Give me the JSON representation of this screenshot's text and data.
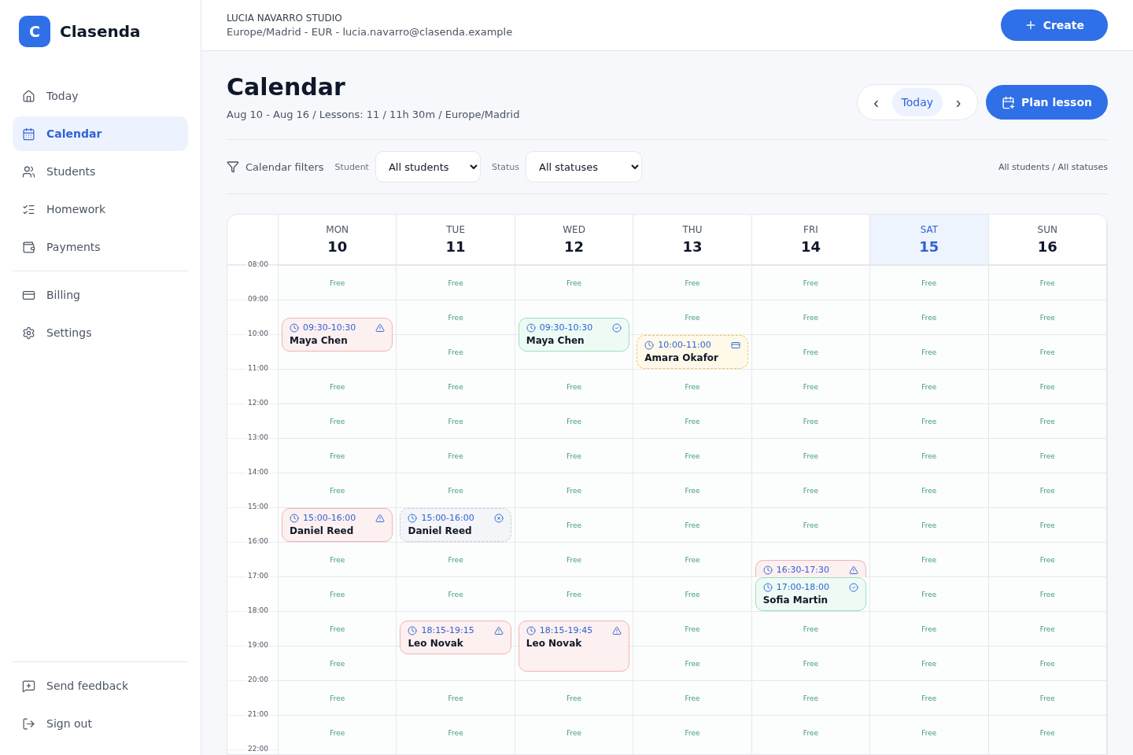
{
  "brand": {
    "logo_letter": "C",
    "name": "Clasenda"
  },
  "sidebar": {
    "items": [
      {
        "label": "Today",
        "selected": false
      },
      {
        "label": "Calendar",
        "selected": true
      },
      {
        "label": "Students",
        "selected": false
      },
      {
        "label": "Homework",
        "selected": false
      },
      {
        "label": "Payments",
        "selected": false
      }
    ],
    "secondary_items": [
      {
        "label": "Billing",
        "selected": false
      },
      {
        "label": "Settings",
        "selected": false
      }
    ],
    "footer_items": [
      {
        "label": "Send feedback"
      },
      {
        "label": "Sign out"
      }
    ]
  },
  "topbar": {
    "studio": "LUCIA NAVARRO STUDIO",
    "details": "Europe/Madrid - EUR - lucia.navarro@clasenda.example",
    "create_button": "Create"
  },
  "page": {
    "title": "Calendar",
    "subtitle": "Aug 10 - Aug 16 / Lessons: 11 / 11h 30m / Europe/Madrid",
    "nav": {
      "prev": "‹",
      "today": "Today",
      "next": "›"
    },
    "plan_button": "Plan lesson"
  },
  "filters": {
    "label": "Calendar filters",
    "student": {
      "label": "Student",
      "value": "All students"
    },
    "status": {
      "label": "Status",
      "value": "All statuses"
    },
    "summary": "All students / All statuses"
  },
  "calendar": {
    "hours": [
      "08:00",
      "09:00",
      "10:00",
      "11:00",
      "12:00",
      "13:00",
      "14:00",
      "15:00",
      "16:00",
      "17:00",
      "18:00",
      "19:00",
      "20:00",
      "21:00",
      "22:00"
    ],
    "days": [
      {
        "dow": "MON",
        "date": "10",
        "selected": false,
        "cells": [
          "Free",
          "",
          "",
          "Free",
          "Free",
          "Free",
          "Free",
          "",
          "Free",
          "Free",
          "Free",
          "Free",
          "Free",
          "Free"
        ],
        "events": [
          {
            "kind": "warning",
            "time": "09:30-10:30",
            "name": "Maya Chen"
          },
          {
            "kind": "warning",
            "time": "15:00-16:00",
            "name": "Daniel Reed"
          }
        ]
      },
      {
        "dow": "TUE",
        "date": "11",
        "selected": false,
        "cells": [
          "Free",
          "Free",
          "Free",
          "Free",
          "Free",
          "Free",
          "Free",
          "",
          "Free",
          "Free",
          "",
          "",
          "Free",
          "Free"
        ],
        "events": [
          {
            "kind": "cancelled",
            "time": "15:00-16:00",
            "name": "Daniel Reed"
          },
          {
            "kind": "warning",
            "time": "18:15-19:15",
            "name": "Leo Novak"
          }
        ]
      },
      {
        "dow": "WED",
        "date": "12",
        "selected": false,
        "cells": [
          "Free",
          "",
          "",
          "Free",
          "Free",
          "Free",
          "Free",
          "Free",
          "Free",
          "Free",
          "",
          "",
          "Free",
          "Free"
        ],
        "events": [
          {
            "kind": "done",
            "time": "09:30-10:30",
            "name": "Maya Chen"
          },
          {
            "kind": "warning",
            "time": "18:15-19:45",
            "name": "Leo Novak"
          }
        ]
      },
      {
        "dow": "THU",
        "date": "13",
        "selected": false,
        "cells": [
          "Free",
          "Free",
          "",
          "Free",
          "Free",
          "Free",
          "Free",
          "Free",
          "Free",
          "Free",
          "Free",
          "Free",
          "Free",
          "Free"
        ],
        "events": [
          {
            "kind": "unpaid",
            "time": "10:00-11:00",
            "name": "Amara Okafor"
          }
        ]
      },
      {
        "dow": "FRI",
        "date": "14",
        "selected": false,
        "cells": [
          "Free",
          "Free",
          "Free",
          "Free",
          "Free",
          "Free",
          "Free",
          "Free",
          "",
          "",
          "Free",
          "Free",
          "Free",
          "Free"
        ],
        "events": [
          {
            "kind": "warning",
            "time": "16:30-17:30"
          },
          {
            "kind": "done",
            "time": "17:00-18:00",
            "name": "Sofia Martin"
          }
        ]
      },
      {
        "dow": "SAT",
        "date": "15",
        "selected": true,
        "cells": [
          "Free",
          "Free",
          "Free",
          "Free",
          "Free",
          "Free",
          "Free",
          "Free",
          "Free",
          "Free",
          "Free",
          "Free",
          "Free",
          "Free"
        ]
      },
      {
        "dow": "SUN",
        "date": "16",
        "selected": false,
        "cells": [
          "Free",
          "Free",
          "Free",
          "Free",
          "Free",
          "Free",
          "Free",
          "Free",
          "Free",
          "Free",
          "Free",
          "Free",
          "Free",
          "Free"
        ]
      }
    ]
  }
}
